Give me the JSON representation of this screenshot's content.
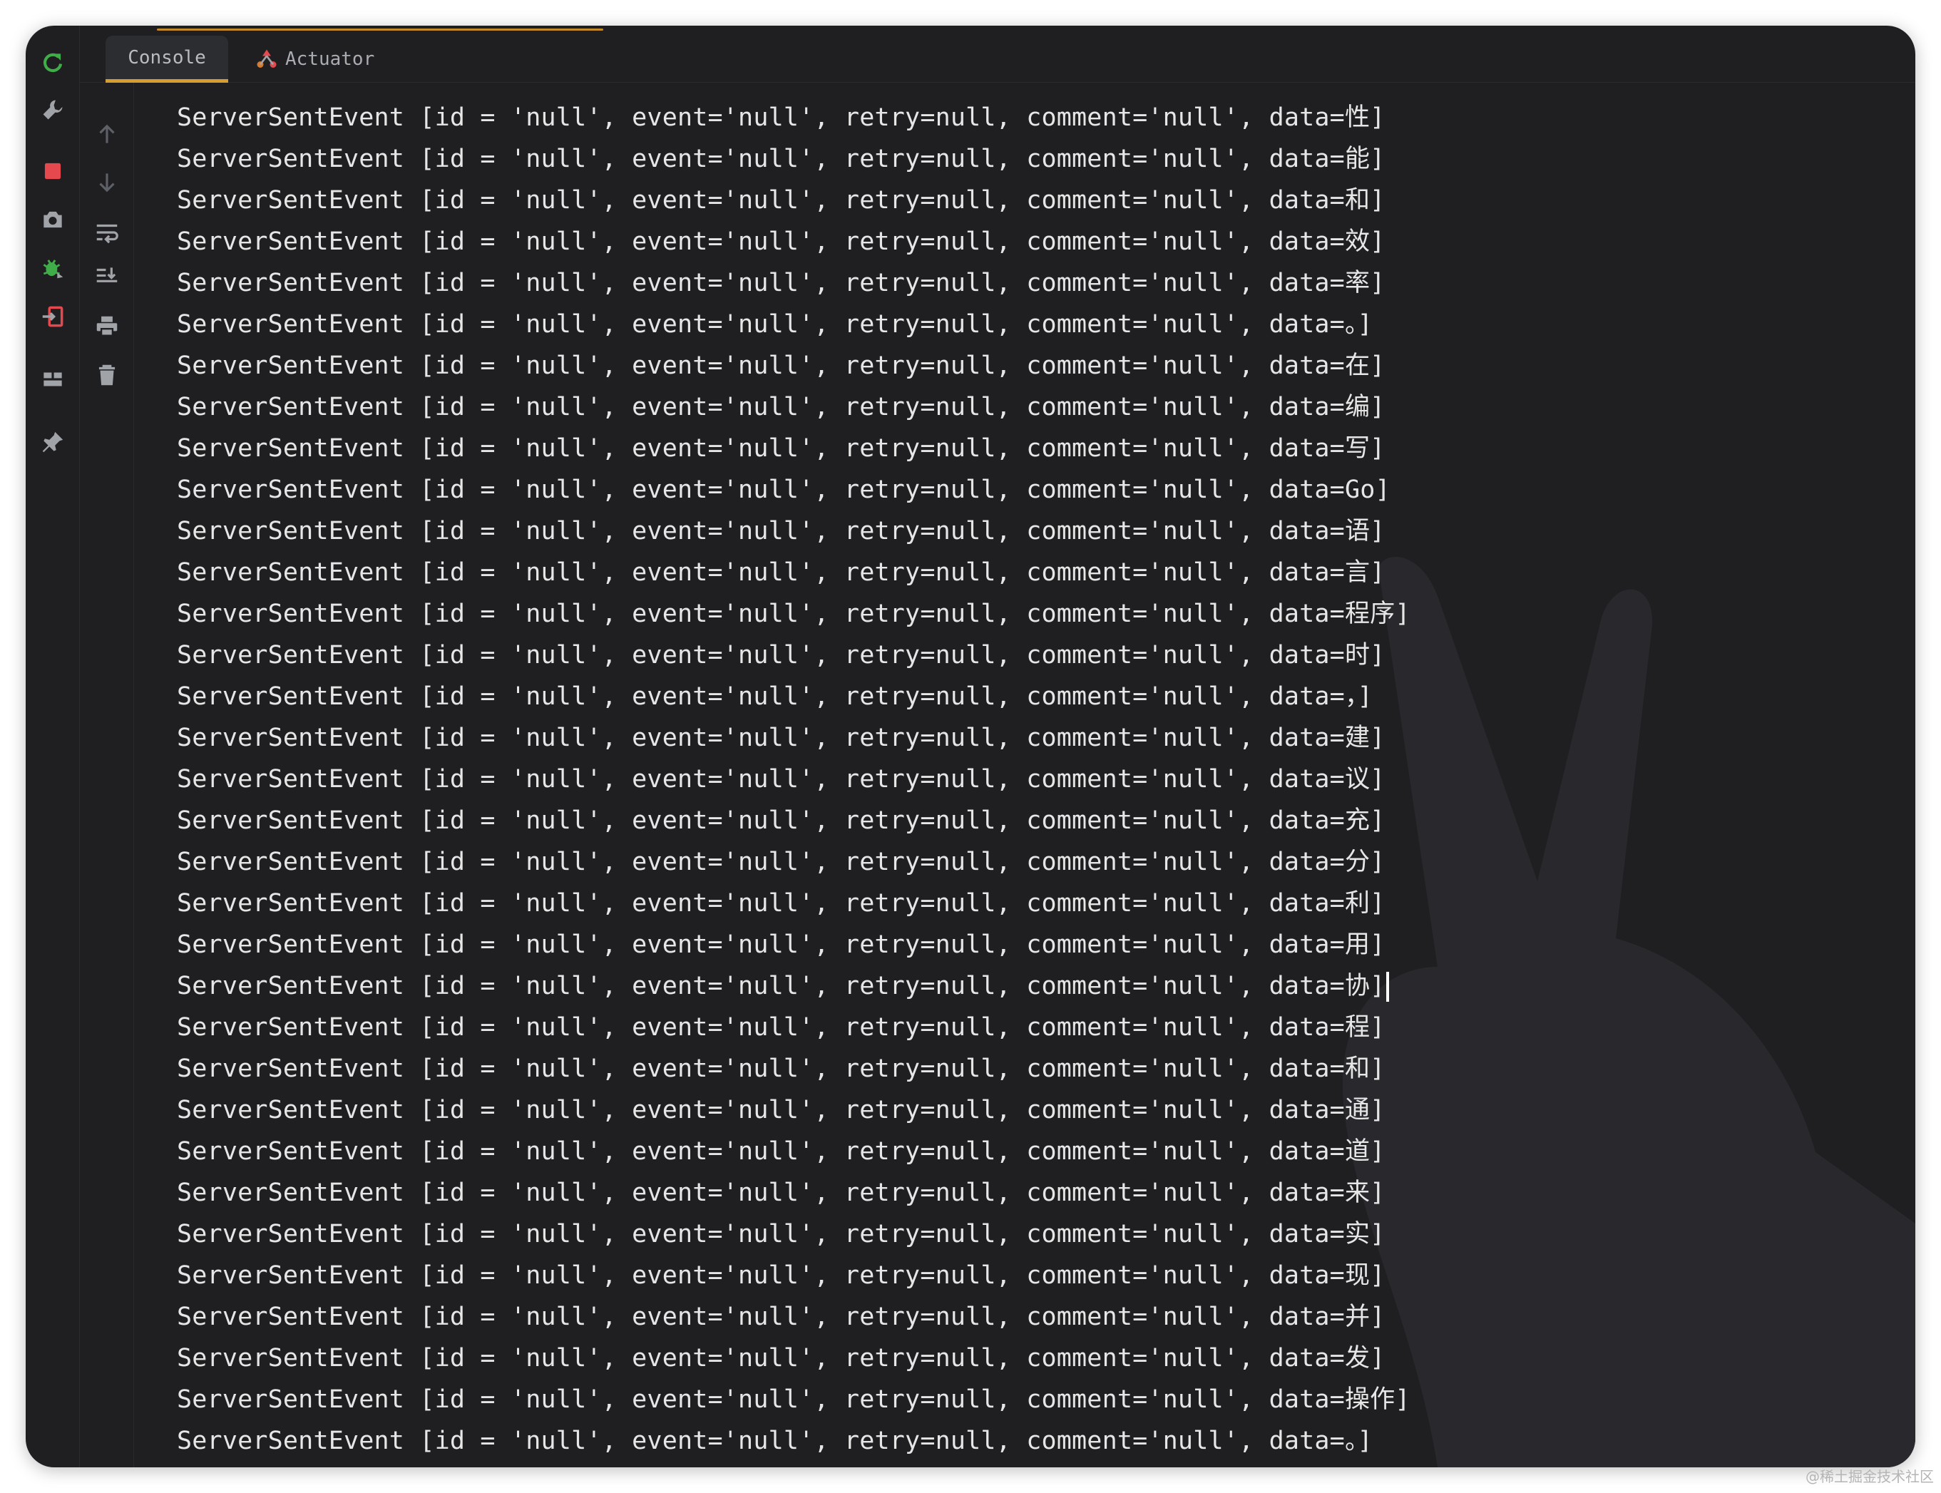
{
  "tabs": [
    {
      "label": "Console",
      "active": true
    },
    {
      "label": "Actuator",
      "active": false
    }
  ],
  "left_toolbar_icons": [
    "rerun-icon",
    "wrench-icon",
    "stop-icon",
    "camera-icon",
    "debug-bug-icon",
    "exit-icon",
    "layout-icon",
    "pin-icon"
  ],
  "sub_toolbar_icons": [
    "arrow-up-icon",
    "arrow-down-icon",
    "soft-wrap-icon",
    "scroll-to-end-icon",
    "print-icon",
    "trash-icon"
  ],
  "colors": {
    "background": "#1f1f21",
    "text": "#e6e6e6",
    "active_tab_underline": "#d69e2e",
    "rerun_green": "#3fae49",
    "stop_red": "#e5484d"
  },
  "console_prefix": "ServerSentEvent [id = 'null', event='null', retry=null, comment='null', data=",
  "console_suffix": "]",
  "console_lines": [
    {
      "data": "性"
    },
    {
      "data": "能"
    },
    {
      "data": "和"
    },
    {
      "data": "效"
    },
    {
      "data": "率"
    },
    {
      "data": "。"
    },
    {
      "data": "在"
    },
    {
      "data": "编"
    },
    {
      "data": "写"
    },
    {
      "data": "Go"
    },
    {
      "data": "语"
    },
    {
      "data": "言"
    },
    {
      "data": "程序"
    },
    {
      "data": "时"
    },
    {
      "data": "，"
    },
    {
      "data": "建"
    },
    {
      "data": "议"
    },
    {
      "data": "充"
    },
    {
      "data": "分"
    },
    {
      "data": "利"
    },
    {
      "data": "用"
    },
    {
      "data": "协",
      "cursor": true
    },
    {
      "data": "程"
    },
    {
      "data": "和"
    },
    {
      "data": "通"
    },
    {
      "data": "道"
    },
    {
      "data": "来"
    },
    {
      "data": "实"
    },
    {
      "data": "现"
    },
    {
      "data": "并"
    },
    {
      "data": "发"
    },
    {
      "data": "操作"
    },
    {
      "data": "。"
    }
  ],
  "watermark": "@稀土掘金技术社区"
}
